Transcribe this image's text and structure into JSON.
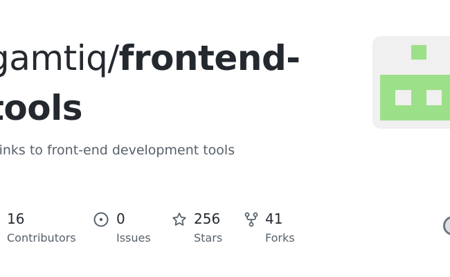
{
  "repo": {
    "owner": "gamtiq/",
    "name_part1": "frontend-",
    "name_part2": "tools",
    "description": "Links to front-end development tools"
  },
  "stats": [
    {
      "value": "16",
      "label": "Contributors",
      "icon": "people-icon"
    },
    {
      "value": "0",
      "label": "Issues",
      "icon": "issue-opened-icon"
    },
    {
      "value": "256",
      "label": "Stars",
      "icon": "star-icon"
    },
    {
      "value": "41",
      "label": "Forks",
      "icon": "repo-forked-icon"
    }
  ],
  "colors": {
    "text": "#24292f",
    "muted": "#57606a",
    "logo_green": "#9de08a",
    "logo_bg": "#f0f0f0"
  }
}
